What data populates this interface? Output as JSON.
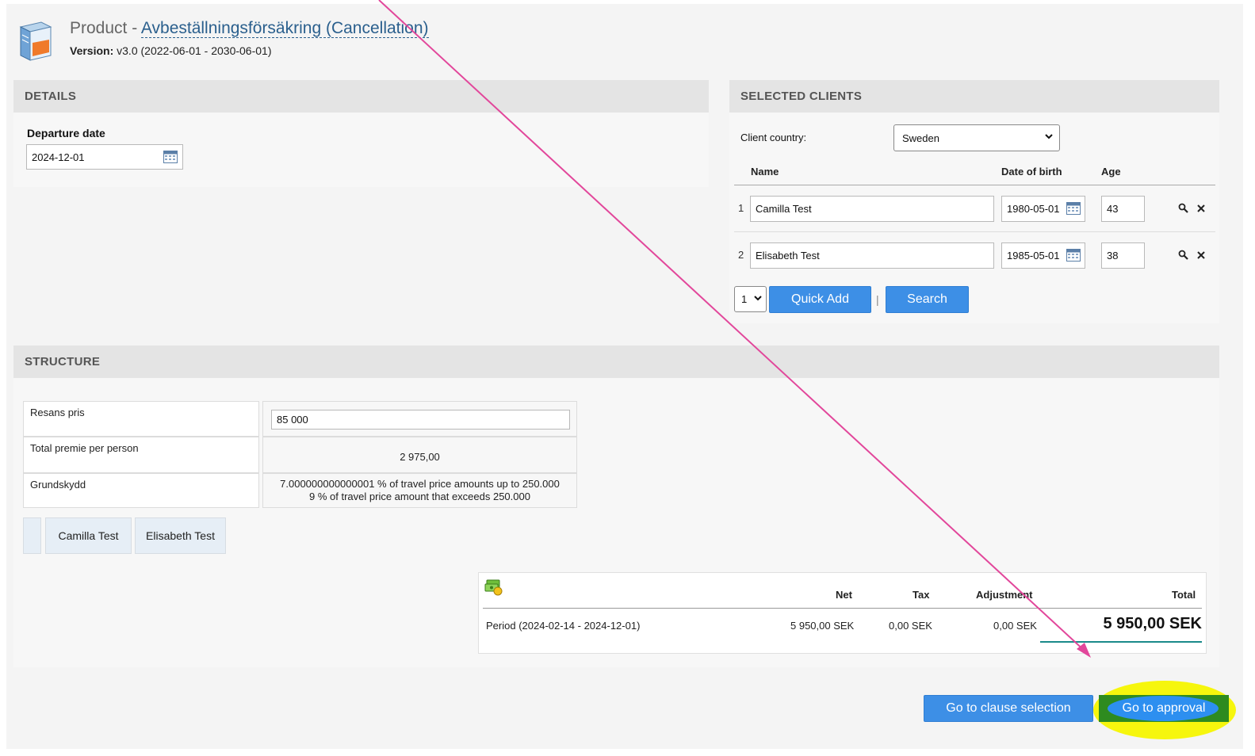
{
  "header": {
    "title_prefix": "Product - ",
    "title_link": "Avbeställningsförsäkring (Cancellation)",
    "version_label": "Version:",
    "version_value": " v3.0 (2022-06-01 - 2030-06-01)"
  },
  "details": {
    "heading": "DETAILS",
    "departure_label": "Departure date",
    "departure_value": "2024-12-01"
  },
  "clients": {
    "heading": "SELECTED CLIENTS",
    "country_label": "Client country:",
    "country_value": "Sweden",
    "col_name": "Name",
    "col_dob": "Date of birth",
    "col_age": "Age",
    "rows": [
      {
        "num": "1",
        "name": "Camilla Test",
        "dob": "1980-05-01",
        "age": "43"
      },
      {
        "num": "2",
        "name": "Elisabeth Test",
        "dob": "1985-05-01",
        "age": "38"
      }
    ],
    "quick_count": "1",
    "quick_add_label": "Quick Add",
    "separator": "|",
    "search_label": "Search"
  },
  "structure": {
    "heading": "STRUCTURE",
    "rows": [
      {
        "label": "Resans pris",
        "value": "85 000"
      },
      {
        "label": "Total premie per person",
        "value": "2 975,00"
      },
      {
        "label": "Grundskydd",
        "value_line1": "7.000000000000001 % of travel price amounts up to 250.000",
        "value_line2": "9 % of travel price amount that exceeds 250.000"
      }
    ],
    "chips": [
      "Camilla Test",
      "Elisabeth Test"
    ]
  },
  "totals": {
    "col_net": "Net",
    "col_tax": "Tax",
    "col_adjustment": "Adjustment",
    "col_total": "Total",
    "period": "Period (2024-02-14 - 2024-12-01)",
    "net": "5 950,00 SEK",
    "tax": "0,00 SEK",
    "adjustment": "0,00 SEK",
    "total": "5 950,00 SEK"
  },
  "actions": {
    "clause_label": "Go to clause selection",
    "approval_label": "Go to approval"
  },
  "colors": {
    "button_blue": "#3d8fe6",
    "annotation_pink": "#e2479b",
    "highlight_yellow": "#f5f500",
    "highlight_green": "#2e8b1f"
  }
}
